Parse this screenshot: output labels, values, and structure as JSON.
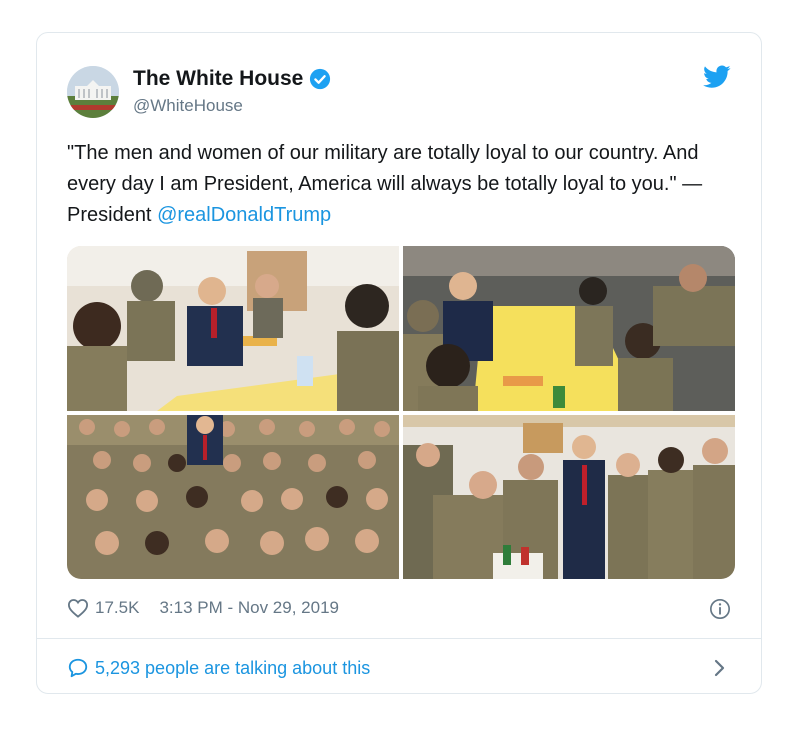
{
  "tweet": {
    "account_name": "The White House",
    "handle": "@WhiteHouse",
    "text_before_mention": "\"The men and women of our military are totally loyal to our country. And every day I am President, America will always be totally loyal to you.\" — President ",
    "mention": "@realDonaldTrump",
    "likes": "17.5K",
    "timestamp": "3:13 PM - Nov 29, 2019",
    "conversation": "5,293 people are talking about this"
  },
  "icons": {
    "verified": "verified-badge-icon",
    "brand": "twitter-bird-icon",
    "like": "heart-icon",
    "info": "info-icon",
    "reply": "speech-bubble-icon",
    "more": "chevron-right-icon"
  },
  "colors": {
    "accent": "#1b95e0",
    "text": "#14171a",
    "muted": "#657786",
    "border": "#e1e8ed",
    "bird": "#1da1f2"
  }
}
